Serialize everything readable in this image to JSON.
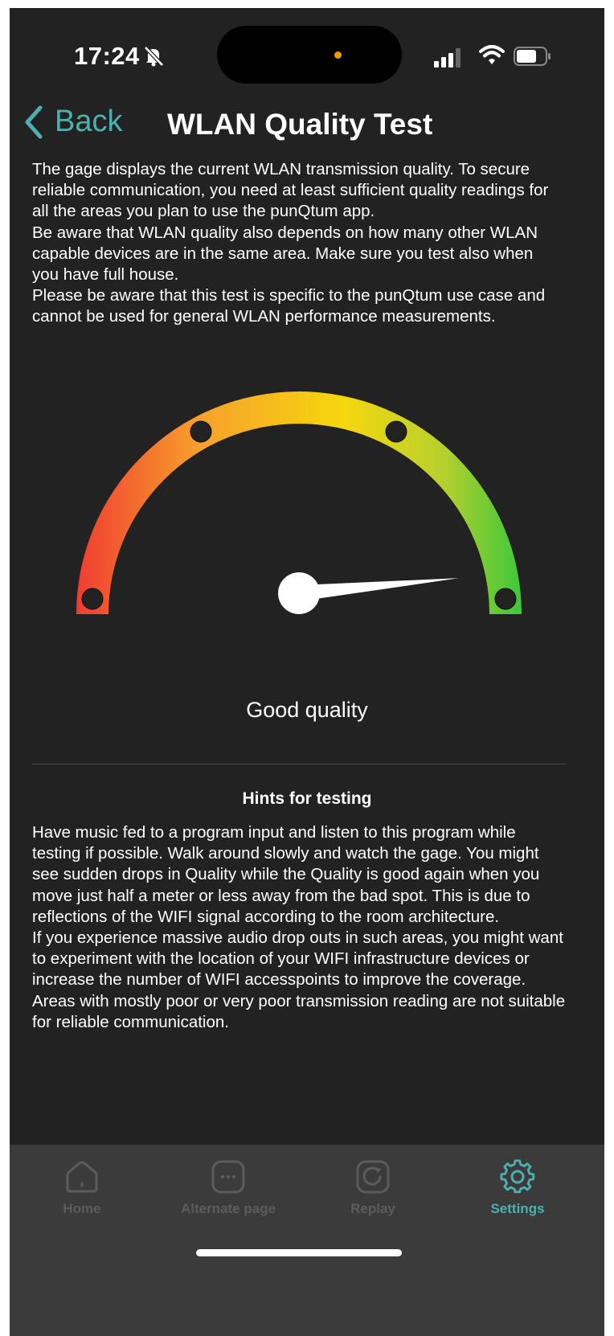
{
  "status_bar": {
    "time": "17:24"
  },
  "nav": {
    "back_label": "Back",
    "title": "WLAN Quality Test"
  },
  "description": [
    "The gage displays the current WLAN transmission quality. To secure reliable communication, you need at least sufficient quality readings for all the areas you plan to use the punQtum app.",
    "Be aware that WLAN quality also depends on how many other WLAN capable devices are in the same area. Make sure you test also when you have full house.",
    "Please be aware that this test is specific to the punQtum use case and cannot be used for general WLAN performance measurements."
  ],
  "gauge": {
    "value_fraction": 0.97,
    "colors": {
      "low": "#f03c32",
      "mid": "#f6d70e",
      "high": "#3cc83a"
    }
  },
  "quality_label": "Good quality",
  "hints": {
    "title": "Hints for testing",
    "paragraphs": [
      "Have music fed to a program input and listen to this program while testing if possible. Walk around slowly and watch the gage. You might see sudden drops in Quality while the Quality is good again when you move just half a meter or less away from the bad spot. This is due to reflections of the WIFI signal according to the room architecture.",
      "If you experience massive audio drop outs in such areas, you might want to experiment with the location of your WIFI infrastructure devices or increase the number of WIFI accesspoints to improve the coverage.",
      "Areas with mostly poor or very poor transmission reading are not suitable for reliable communication."
    ]
  },
  "tabs": [
    {
      "label": "Home",
      "icon": "home-icon",
      "active": false
    },
    {
      "label": "Alternate page",
      "icon": "more-icon",
      "active": false
    },
    {
      "label": "Replay",
      "icon": "replay-icon",
      "active": false
    },
    {
      "label": "Settings",
      "icon": "gear-icon",
      "active": true
    }
  ],
  "accent_color": "#4db0ae"
}
